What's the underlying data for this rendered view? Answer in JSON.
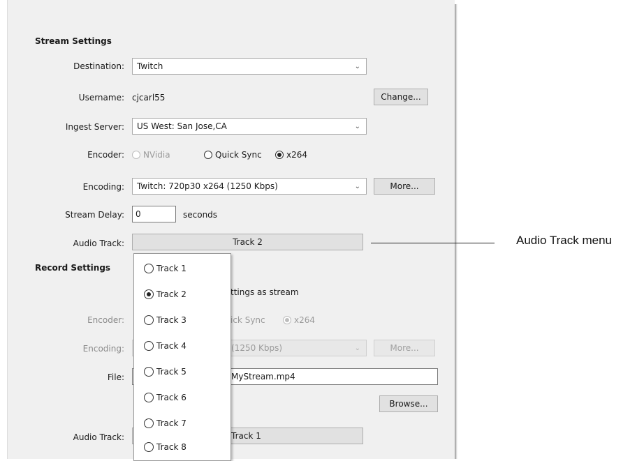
{
  "stream_settings": {
    "heading": "Stream Settings",
    "destination": {
      "label": "Destination:",
      "value": "Twitch"
    },
    "username": {
      "label": "Username:",
      "value": "cjcarl55",
      "change_button": "Change..."
    },
    "ingest_server": {
      "label": "Ingest Server:",
      "value": "US West: San Jose,CA"
    },
    "encoder": {
      "label": "Encoder:",
      "options": [
        {
          "label": "NVidia",
          "selected": false,
          "enabled": false
        },
        {
          "label": "Quick Sync",
          "selected": false,
          "enabled": true
        },
        {
          "label": "x264",
          "selected": true,
          "enabled": true
        }
      ]
    },
    "encoding": {
      "label": "Encoding:",
      "value": "Twitch: 720p30 x264 (1250 Kbps)",
      "more_button": "More..."
    },
    "stream_delay": {
      "label": "Stream Delay:",
      "value": "0",
      "unit": "seconds"
    },
    "audio_track": {
      "label": "Audio Track:",
      "value": "Track 2"
    }
  },
  "record_settings": {
    "heading": "Record Settings",
    "same_as_stream_fragment": "ttings as stream",
    "encoder": {
      "label": "Encoder:",
      "quick_sync_fragment": "ick Sync",
      "x264": "x264"
    },
    "encoding": {
      "label": "Encoding:",
      "value_fragment": "(1250 Kbps)",
      "more_button": "More..."
    },
    "file": {
      "label": "File:",
      "value_fragment": "MyStream.mp4",
      "browse_button": "Browse..."
    },
    "audio_track": {
      "label": "Audio Track:",
      "value": "Track 1"
    }
  },
  "audio_track_menu": {
    "items": [
      {
        "label": "Track 1",
        "selected": false
      },
      {
        "label": "Track 2",
        "selected": true
      },
      {
        "label": "Track 3",
        "selected": false
      },
      {
        "label": "Track 4",
        "selected": false
      },
      {
        "label": "Track 5",
        "selected": false
      },
      {
        "label": "Track 6",
        "selected": false
      },
      {
        "label": "Track 7",
        "selected": false
      },
      {
        "label": "Track 8",
        "selected": false
      }
    ]
  },
  "callout": {
    "text": "Audio Track menu"
  }
}
